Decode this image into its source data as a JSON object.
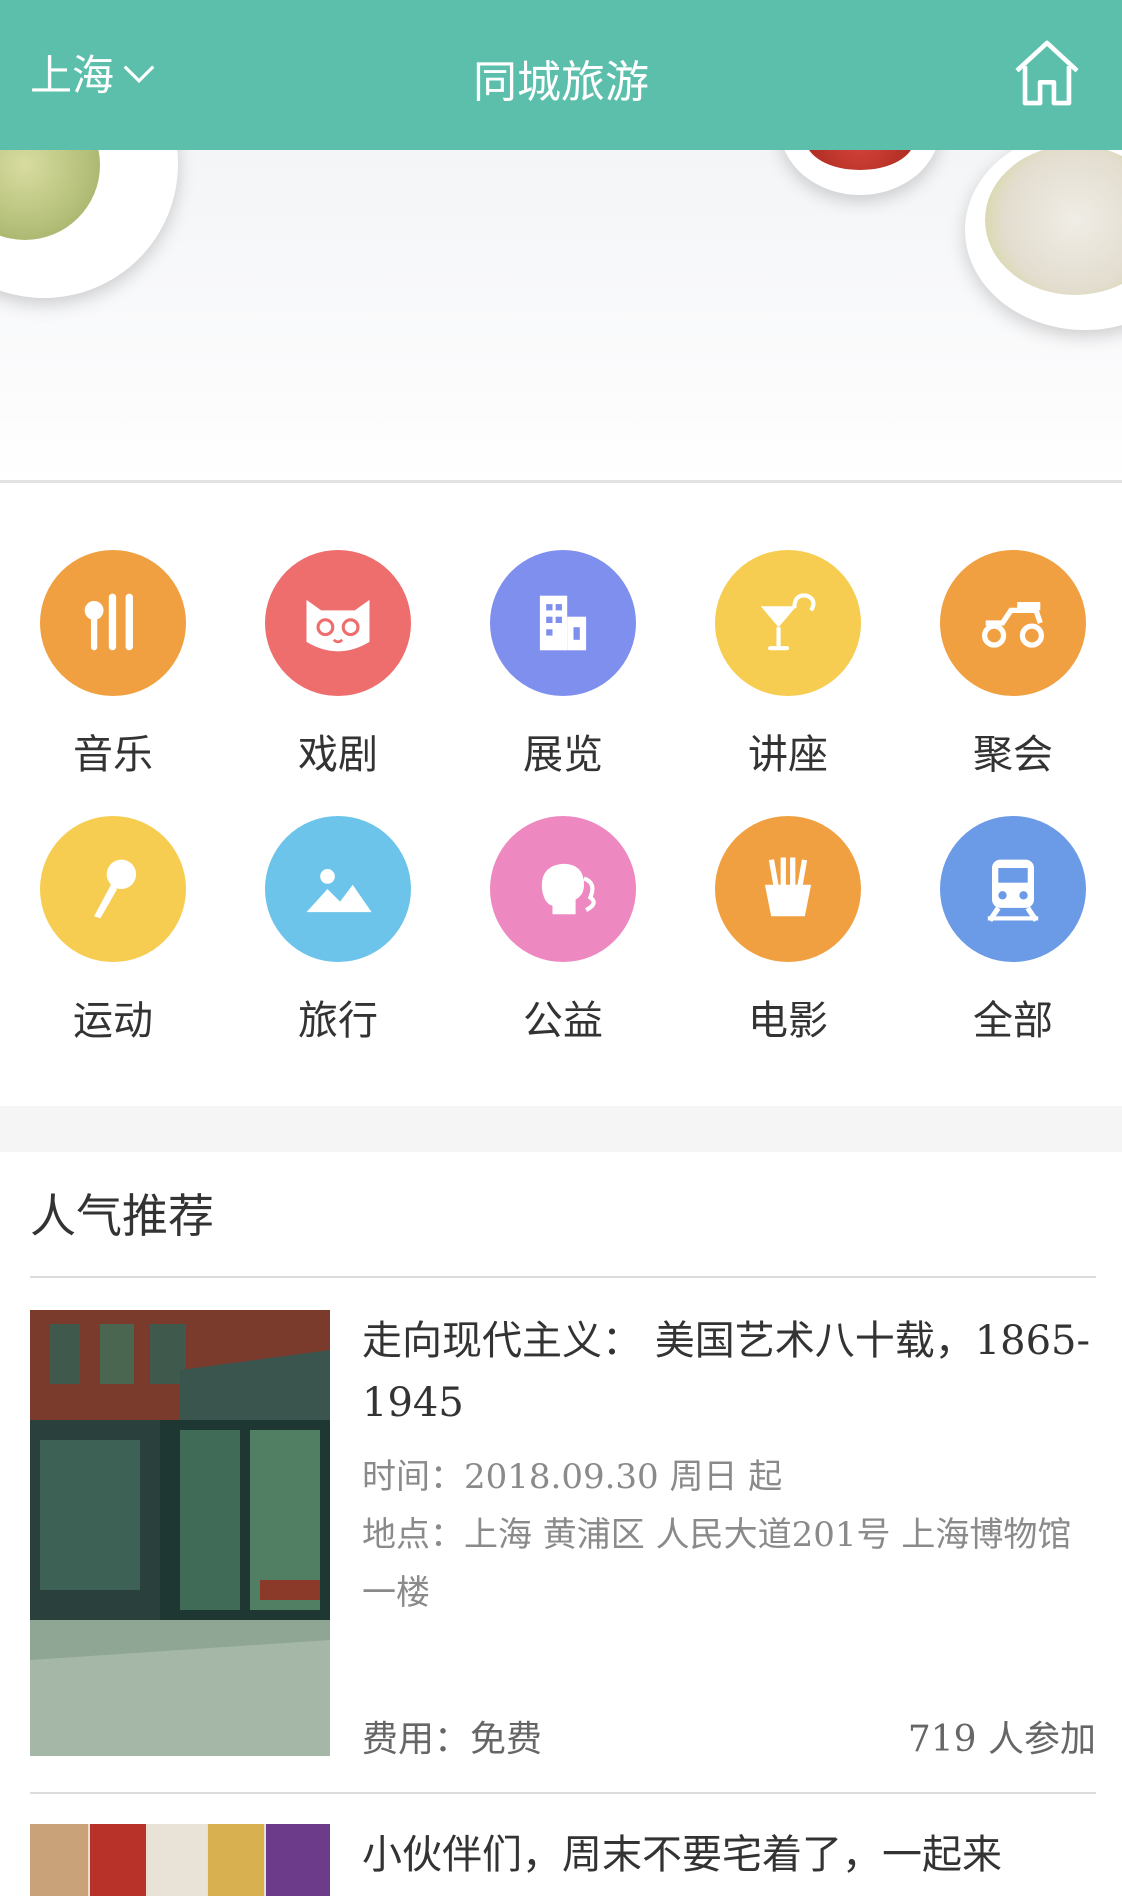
{
  "header": {
    "city": "上海",
    "title": "同城旅游"
  },
  "categories": [
    {
      "label": "音乐",
      "color": "#f0a040",
      "icon": "fork-knife-icon"
    },
    {
      "label": "戏剧",
      "color": "#ee6e6e",
      "icon": "cat-face-icon"
    },
    {
      "label": "展览",
      "color": "#7f8fee",
      "icon": "building-icon"
    },
    {
      "label": "讲座",
      "color": "#f6cd50",
      "icon": "cocktail-icon"
    },
    {
      "label": "聚会",
      "color": "#f0a040",
      "icon": "scooter-icon"
    },
    {
      "label": "运动",
      "color": "#f6cd50",
      "icon": "microphone-icon"
    },
    {
      "label": "旅行",
      "color": "#6cc4ea",
      "icon": "landscape-icon"
    },
    {
      "label": "公益",
      "color": "#ee88c0",
      "icon": "person-head-icon"
    },
    {
      "label": "电影",
      "color": "#f0a040",
      "icon": "fries-icon"
    },
    {
      "label": "全部",
      "color": "#6b9ae6",
      "icon": "train-icon"
    }
  ],
  "recommend": {
    "title": "人气推荐",
    "items": [
      {
        "name": "走向现代主义： 美国艺术八十载，1865-1945",
        "time": "时间：2018.09.30 周日 起",
        "place": "地点：上海 黄浦区 人民大道201号 上海博物馆一楼",
        "fee": "费用：免费",
        "count": "719 人参加"
      },
      {
        "name": "小伙伴们，周末不要宅着了，一起来"
      }
    ]
  }
}
